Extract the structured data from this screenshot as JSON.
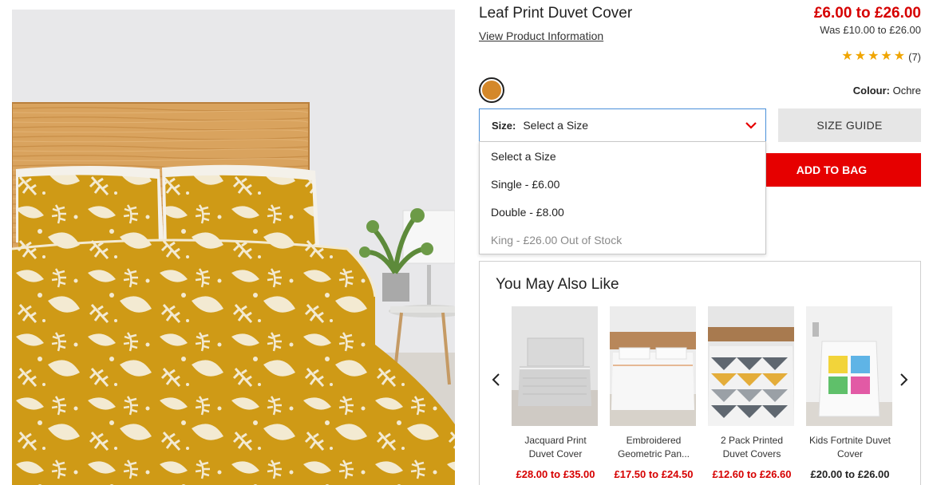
{
  "product": {
    "title": "Leaf Print Duvet Cover",
    "view_info_link": "View Product Information",
    "price": "£6.00 to £26.00",
    "was_price": "Was £10.00 to £26.00",
    "rating_stars": 5,
    "rating_count": "(7)",
    "colour_label": "Colour:",
    "colour_value": "Ochre",
    "swatch_color": "#d4882a"
  },
  "size": {
    "label": "Size:",
    "selected": "Select a Size",
    "guide_button": "SIZE GUIDE",
    "add_to_bag": "ADD TO BAG",
    "options": [
      {
        "label": "Select a Size",
        "in_stock": true
      },
      {
        "label": "Single - £6.00",
        "in_stock": true
      },
      {
        "label": "Double - £8.00",
        "in_stock": true
      },
      {
        "label": "King - £26.00 Out of Stock",
        "in_stock": false
      }
    ]
  },
  "recommendations": {
    "title": "You May Also Like",
    "items": [
      {
        "name": "Jacquard Print Duvet Cover",
        "price": "£28.00 to £35.00",
        "price_color": "#d60000"
      },
      {
        "name": "Embroidered Geometric Pan...",
        "price": "£17.50 to £24.50",
        "price_color": "#d60000"
      },
      {
        "name": "2 Pack Printed Duvet Covers",
        "price": "£12.60 to £26.60",
        "price_color": "#d60000"
      },
      {
        "name": "Kids Fortnite Duvet Cover",
        "price": "£20.00 to £26.00",
        "price_color": "#222222"
      }
    ]
  },
  "colors": {
    "accent_red": "#e60000",
    "price_red": "#d60000",
    "ochre": "#d4882a",
    "select_border": "#4a90d9"
  }
}
